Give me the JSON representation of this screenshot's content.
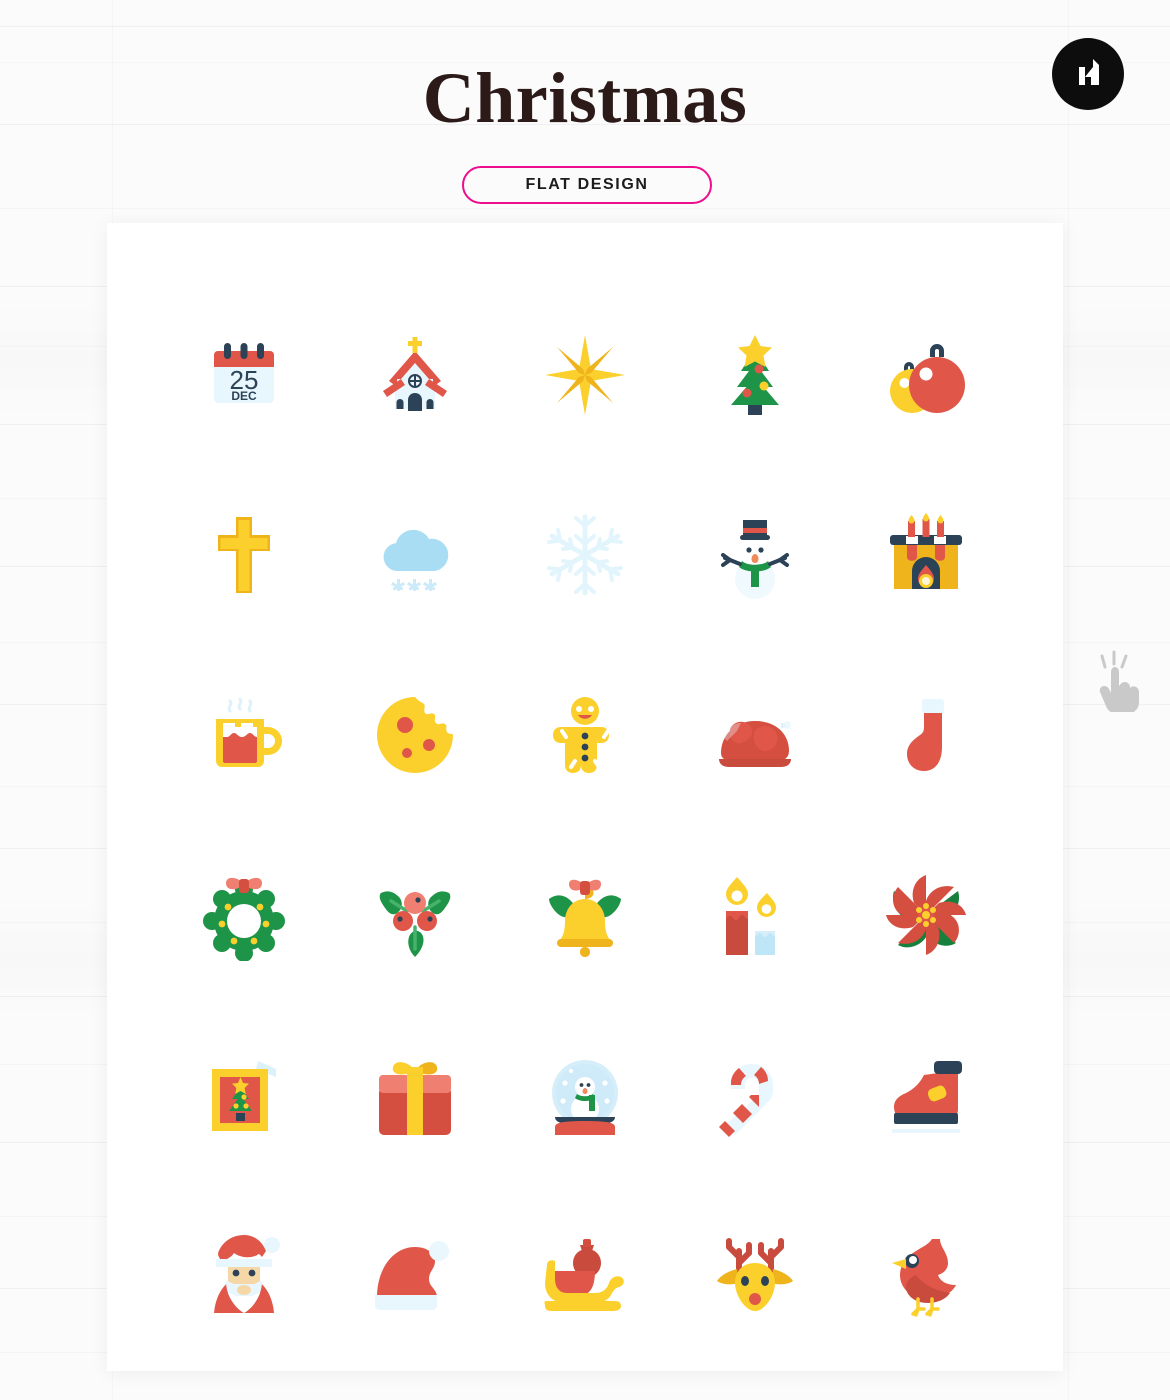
{
  "header": {
    "title": "Christmas",
    "badge_label": "FLAT DESIGN",
    "badge_border_color": "#ec0e8c",
    "title_color": "#2b1a17"
  },
  "logo": {
    "name": "brand-logo",
    "shape": "circle",
    "background_color": "#0d0d0d",
    "mark_color": "#ffffff"
  },
  "card": {
    "background_color": "#ffffff"
  },
  "palette": {
    "red": "#e0574a",
    "red_dark": "#c94b3d",
    "red_light": "#ef7f70",
    "yellow": "#fbd02d",
    "yellow_dark": "#efb31b",
    "green": "#1e9448",
    "green_dark": "#17803c",
    "navy": "#2b4257",
    "ice": "#e8f6fd",
    "sky": "#a9ddf3",
    "cream": "#f6d7a8"
  },
  "cursor": {
    "name": "hand-pointer-cursor",
    "color": "#c9c9c9"
  },
  "grid": {
    "columns": 5,
    "rows": 6,
    "total": 30,
    "icons": [
      {
        "id": 1,
        "name": "calendar-icon",
        "label": "Calendar 25 December",
        "text_day": "25",
        "text_month": "DEC"
      },
      {
        "id": 2,
        "name": "church-icon",
        "label": "Church"
      },
      {
        "id": 3,
        "name": "star-icon",
        "label": "Eight-pointed Star"
      },
      {
        "id": 4,
        "name": "christmas-tree-icon",
        "label": "Christmas Tree"
      },
      {
        "id": 5,
        "name": "baubles-icon",
        "label": "Christmas Baubles"
      },
      {
        "id": 6,
        "name": "cross-icon",
        "label": "Cross"
      },
      {
        "id": 7,
        "name": "snow-cloud-icon",
        "label": "Snow Cloud"
      },
      {
        "id": 8,
        "name": "snowflake-icon",
        "label": "Snowflake"
      },
      {
        "id": 9,
        "name": "snowman-icon",
        "label": "Snowman"
      },
      {
        "id": 10,
        "name": "fireplace-icon",
        "label": "Fireplace"
      },
      {
        "id": 11,
        "name": "hot-cocoa-icon",
        "label": "Hot Cocoa Mug"
      },
      {
        "id": 12,
        "name": "cookie-icon",
        "label": "Bitten Cookie"
      },
      {
        "id": 13,
        "name": "gingerbread-man-icon",
        "label": "Gingerbread Man"
      },
      {
        "id": 14,
        "name": "roast-turkey-icon",
        "label": "Roast Turkey"
      },
      {
        "id": 15,
        "name": "stocking-icon",
        "label": "Christmas Stocking"
      },
      {
        "id": 16,
        "name": "wreath-icon",
        "label": "Christmas Wreath"
      },
      {
        "id": 17,
        "name": "holly-icon",
        "label": "Holly with Berries"
      },
      {
        "id": 18,
        "name": "bell-icon",
        "label": "Christmas Bell"
      },
      {
        "id": 19,
        "name": "candles-icon",
        "label": "Candles"
      },
      {
        "id": 20,
        "name": "poinsettia-icon",
        "label": "Poinsettia Flower"
      },
      {
        "id": 21,
        "name": "christmas-card-icon",
        "label": "Christmas Card"
      },
      {
        "id": 22,
        "name": "gift-box-icon",
        "label": "Gift Box"
      },
      {
        "id": 23,
        "name": "snow-globe-icon",
        "label": "Snow Globe"
      },
      {
        "id": 24,
        "name": "candy-cane-icon",
        "label": "Candy Cane"
      },
      {
        "id": 25,
        "name": "ice-skate-icon",
        "label": "Ice Skate Boot"
      },
      {
        "id": 26,
        "name": "santa-claus-icon",
        "label": "Santa Claus"
      },
      {
        "id": 27,
        "name": "santa-hat-icon",
        "label": "Santa Hat"
      },
      {
        "id": 28,
        "name": "sleigh-icon",
        "label": "Sleigh with Sack"
      },
      {
        "id": 29,
        "name": "reindeer-icon",
        "label": "Reindeer"
      },
      {
        "id": 30,
        "name": "cardinal-bird-icon",
        "label": "Cardinal Bird"
      }
    ]
  }
}
